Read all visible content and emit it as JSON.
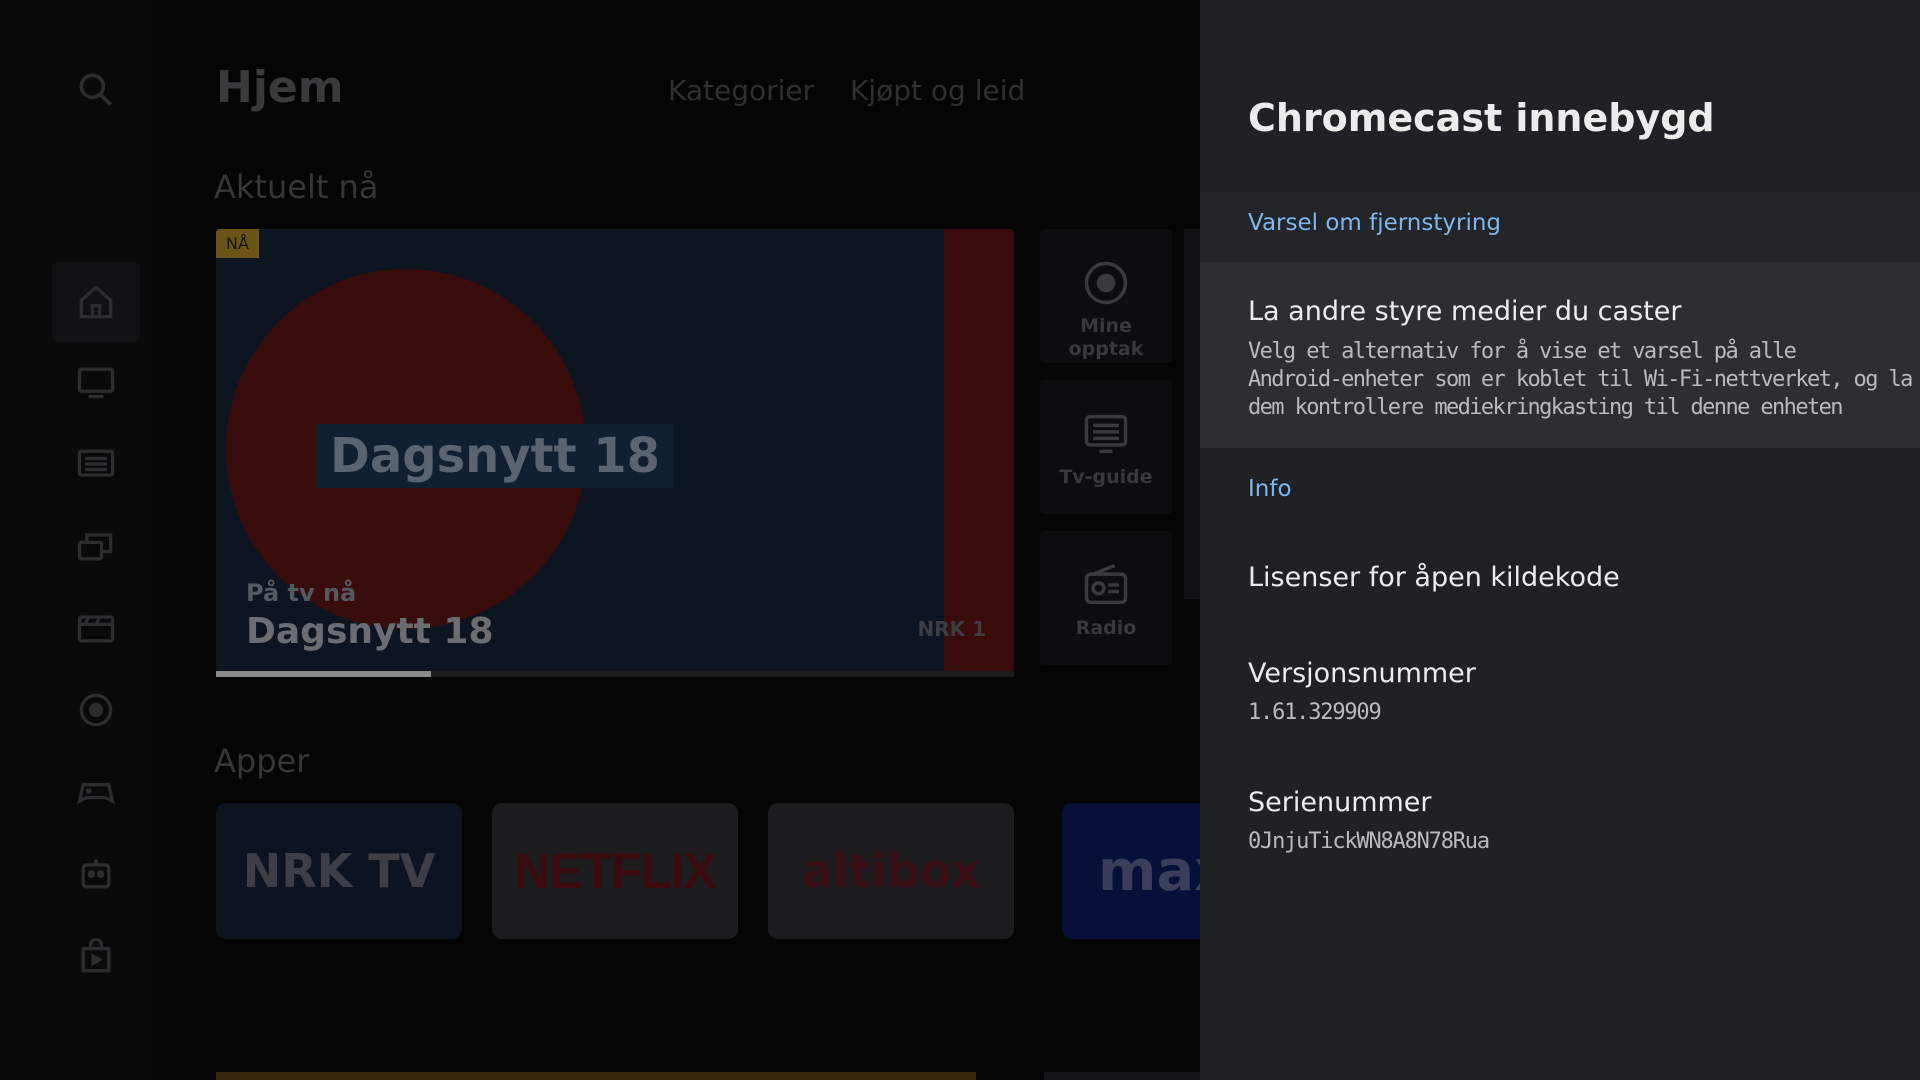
{
  "home": {
    "title": "Hjem",
    "tabs": [
      "Kategorier",
      "Kjøpt og leid"
    ],
    "sections": {
      "current": "Aktuelt nå",
      "apps": "Apper"
    },
    "feature": {
      "badge": "NÅ",
      "overlay_title": "Dagsnytt 18",
      "subtitle": "På tv nå",
      "title": "Dagsnytt 18",
      "channel_logo": "NRK 1",
      "progress_percent": 27
    },
    "side_tiles": [
      {
        "label": "Mine opptak",
        "icon": "recordings-icon"
      },
      {
        "label": "Tv-guide",
        "icon": "tv-guide-icon"
      },
      {
        "label": "Radio",
        "icon": "radio-icon"
      }
    ],
    "apps": [
      {
        "label": "NRK TV",
        "bg": "#0c1420",
        "color": "#3c4046"
      },
      {
        "label": "NETFLIX",
        "bg": "#1c1c1e",
        "color": "#3b0a0c"
      },
      {
        "label": "altibox",
        "bg": "#1c1c1e",
        "color": "#3a1016"
      },
      {
        "label": "max",
        "bg": "#08103a",
        "color": "#3a3e5a"
      }
    ],
    "rail_icons": [
      "search-icon",
      "home-icon",
      "tv-icon",
      "guide-icon",
      "library-icon",
      "movies-icon",
      "recordings-icon",
      "games-icon",
      "kids-icon",
      "store-icon"
    ]
  },
  "panel": {
    "title": "Chromecast innebygd",
    "remote_section": "Varsel om fjernstyring",
    "cast_item": {
      "title": "La andre styre medier du caster",
      "desc_lines": [
        "Velg et alternativ for å vise et varsel på alle",
        "Android-enheter som er koblet til Wi-Fi-nettverket, og la",
        "dem kontrollere mediekringkasting til denne enheten"
      ]
    },
    "info_section": "Info",
    "licenses": "Lisenser for åpen kildekode",
    "version": {
      "label": "Versjonsnummer",
      "value": "1.61.329909"
    },
    "serial": {
      "label": "Serienummer",
      "value": "0JnjuTickWN8A8N78Rua"
    }
  },
  "colors": {
    "accent": "#7db6f0",
    "panel_bg": "#202124",
    "selected_bg": "#2d2e31"
  }
}
